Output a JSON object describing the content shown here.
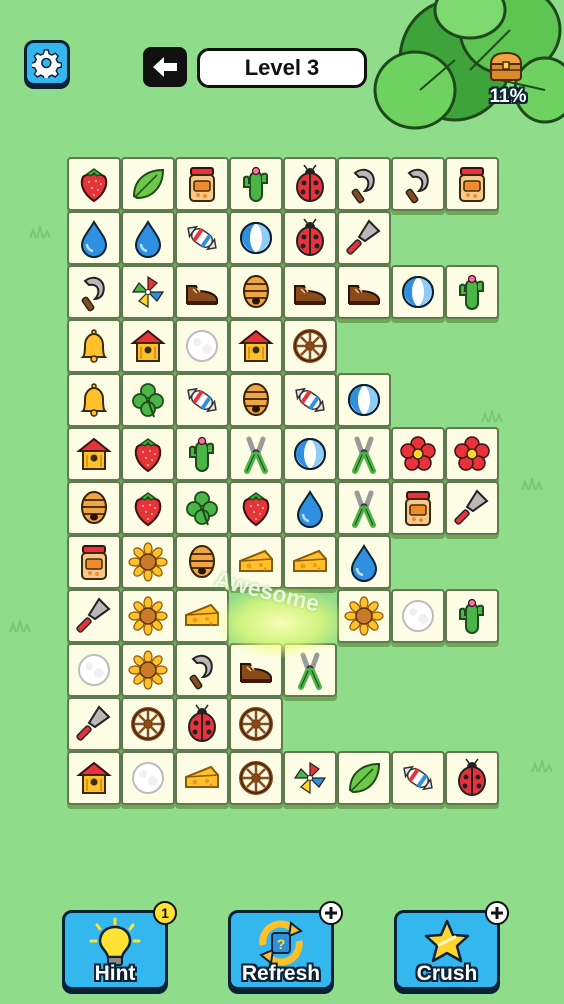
{
  "header": {
    "level_label": "Level 3",
    "chest_progress": "11%"
  },
  "colors": {
    "background": "#8fdc8a",
    "tile_face": "#fdfde6",
    "button_blue": "#34b6ef",
    "badge_yellow": "#ffe234"
  },
  "board": {
    "rows": [
      [
        "strawberry",
        "leaf",
        "jar",
        "cactus",
        "ladybug",
        "sickle",
        "sickle",
        "jar"
      ],
      [
        "water-drop",
        "water-drop",
        "candy",
        "beach-ball",
        "ladybug",
        "trowel"
      ],
      [
        "sickle",
        "pinwheel",
        "shoe",
        "beehive",
        "shoe",
        "shoe",
        "beach-ball",
        "cactus"
      ],
      [
        "bell",
        "birdhouse",
        "cotton-ball",
        "birdhouse",
        "wagon-wheel"
      ],
      [
        "bell",
        "clover",
        "candy",
        "beehive",
        "candy",
        "beach-ball"
      ],
      [
        "birdhouse",
        "strawberry",
        "cactus",
        "pliers",
        "beach-ball",
        "pliers",
        "flower",
        "flower"
      ],
      [
        "beehive",
        "strawberry",
        "clover",
        "strawberry",
        "water-drop",
        "pliers",
        "jar",
        "trowel"
      ],
      [
        "jar",
        "sunflower",
        "beehive",
        "cheese",
        "cheese",
        "water-drop"
      ],
      [
        "trowel",
        "sunflower",
        "cheese",
        null,
        null,
        "sunflower",
        "cotton-ball",
        "cactus"
      ],
      [
        "cotton-ball",
        "sunflower",
        "sickle",
        "shoe",
        "pliers"
      ],
      [
        "trowel",
        "wagon-wheel",
        "ladybug",
        "wagon-wheel"
      ],
      [
        "birdhouse",
        "cotton-ball",
        "cheese",
        "wagon-wheel",
        "pinwheel",
        "leaf",
        "candy",
        "ladybug"
      ]
    ]
  },
  "combo_text": "Awesome",
  "actions": {
    "hint": {
      "label": "Hint",
      "count": "1"
    },
    "refresh": {
      "label": "Refresh"
    },
    "crush": {
      "label": "Crush"
    }
  }
}
